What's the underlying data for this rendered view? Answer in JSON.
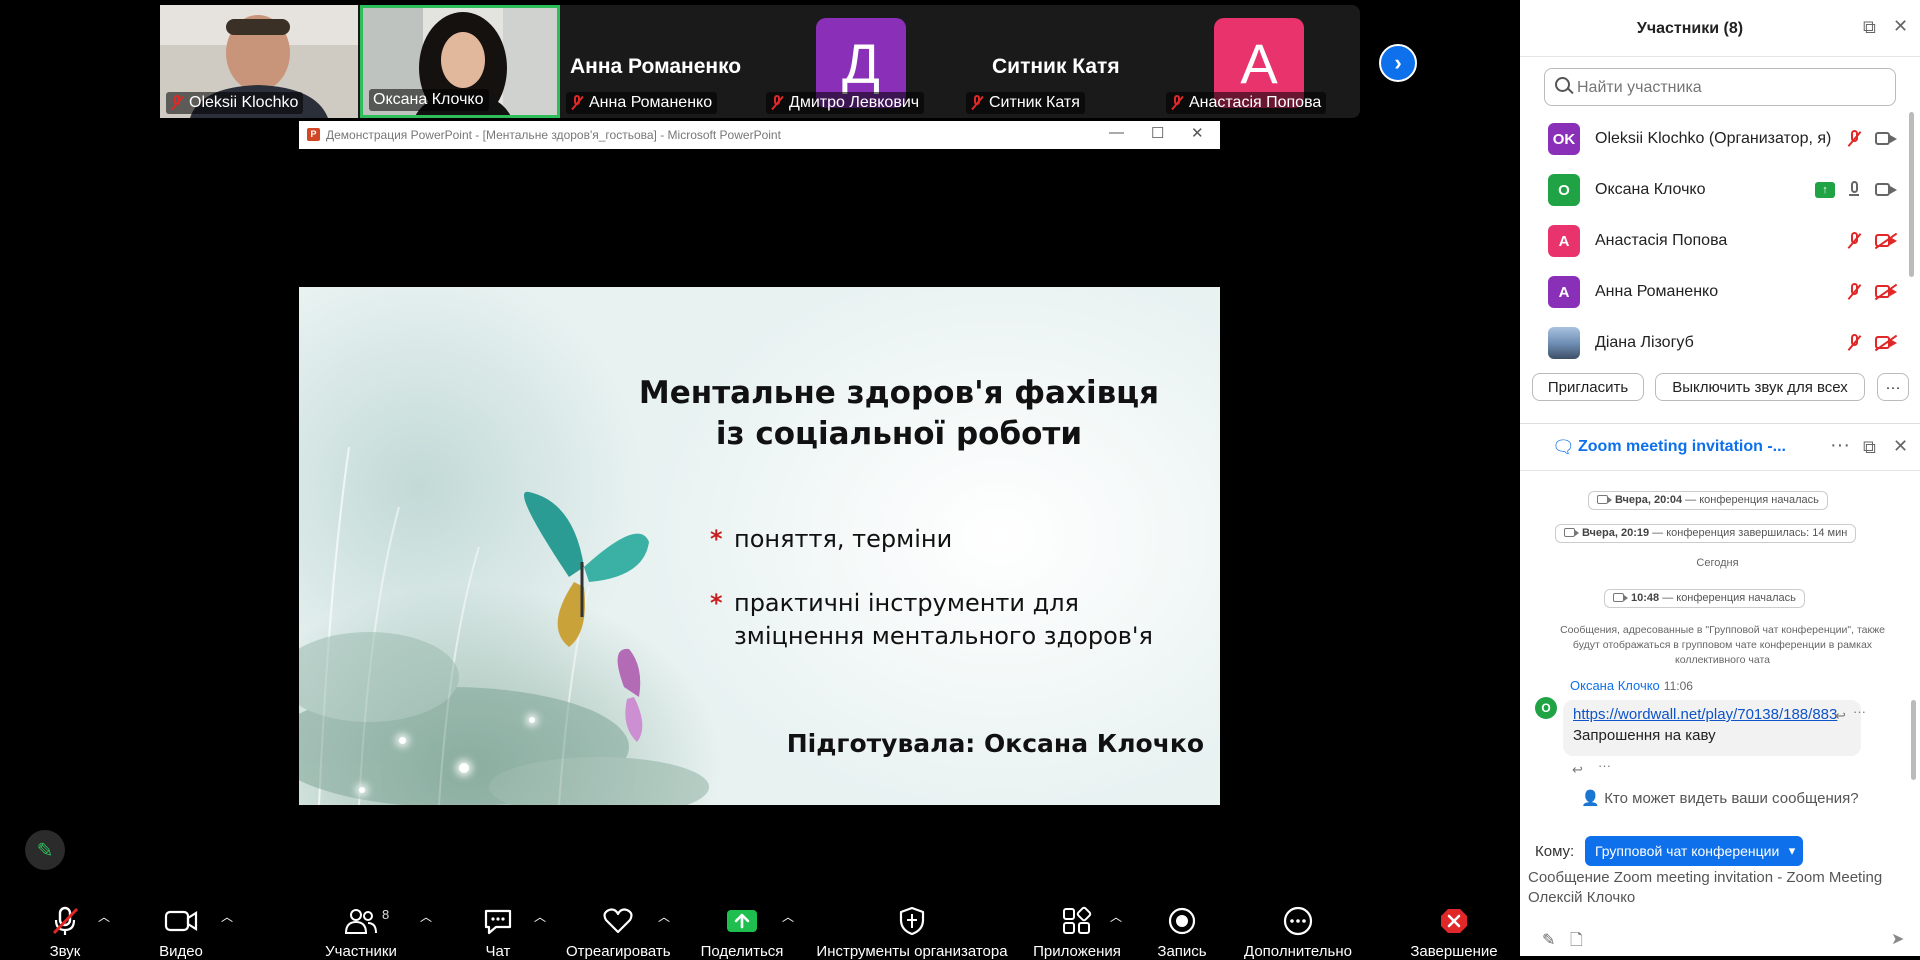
{
  "gallery": {
    "tiles": [
      {
        "name": "Oleksii Klochko"
      },
      {
        "name": "Оксана Клочко"
      },
      {
        "name": "Анна Романенко",
        "big_name": "Анна Романенко"
      },
      {
        "name": "Дмитро Левкович",
        "initial": "Д",
        "color": "#8a2fb8"
      },
      {
        "name": "Ситник Катя",
        "big_name": "Ситник Катя"
      },
      {
        "name": "Анастасія Попова",
        "initial": "А",
        "color": "#e8336d"
      }
    ],
    "next_icon": "›"
  },
  "ppt": {
    "title": "Демонстрация PowerPoint - [Ментальне здоров'я_гостьова] - Microsoft PowerPoint",
    "logo": "P",
    "slide": {
      "title_line1": "Ментальне здоров'я фахівця",
      "title_line2": "із соціальної роботи",
      "bullet1": "поняття, терміни",
      "bullet2_line1": "практичні інструменти для",
      "bullet2_line2": "зміцнення ментального здоров'я",
      "bullet_marker": "*",
      "author": "Підготувала: Оксана Клочко"
    }
  },
  "toolbar": {
    "audio": "Звук",
    "video": "Видео",
    "participants": "Участники",
    "participants_count": "8",
    "chat": "Чат",
    "react": "Отреагировать",
    "share": "Поделиться",
    "host_tools": "Инструменты организатора",
    "apps": "Приложения",
    "record": "Запись",
    "more": "Дополнительно",
    "end": "Завершение"
  },
  "participants_panel": {
    "title": "Участники (8)",
    "search_placeholder": "Найти участника",
    "items": [
      {
        "initials": "OK",
        "name": "Oleksii Klochko (Организатор, я)",
        "color": "#8a2fb8"
      },
      {
        "initials": "О",
        "name": "Оксана Клочко",
        "color": "#1fa345"
      },
      {
        "initials": "А",
        "name": "Анастасія Попова",
        "color": "#e8336d"
      },
      {
        "initials": "А",
        "name": "Анна Романенко",
        "color": "#8a2fb8"
      },
      {
        "initials": "",
        "name": "Діана Лізогуб",
        "color": "#7b8fa8"
      }
    ],
    "invite": "Пригласить",
    "mute_all": "Выключить звук для всех",
    "more": "···"
  },
  "chat": {
    "title": "Zoom meeting invitation -...",
    "events": [
      {
        "time": "Вчера, 20:04",
        "text": " — конференция началась"
      },
      {
        "time": "Вчера, 20:19",
        "text": " — конференция завершилась: 14 мин"
      },
      {
        "time": "10:48",
        "text": " — конференция началась"
      }
    ],
    "today": "Сегодня",
    "note": "Сообщения, адресованные в \"Групповой чат конференции\", также будут отображаться в групповом чате конференции в рамках коллективного чата",
    "message": {
      "sender": "Оксана Клочко",
      "time": "11:06",
      "avatar": "О",
      "link": "https://wordwall.net/play/70138/188/883",
      "text": "Запрошення на каву"
    },
    "who_sees": "Кто может видеть ваши сообщения?",
    "to_label": "Кому:",
    "to_value": "Групповой чат конференции",
    "composer_text": "Сообщение Zoom meeting invitation - Zoom Meeting Олексій Клочко"
  }
}
